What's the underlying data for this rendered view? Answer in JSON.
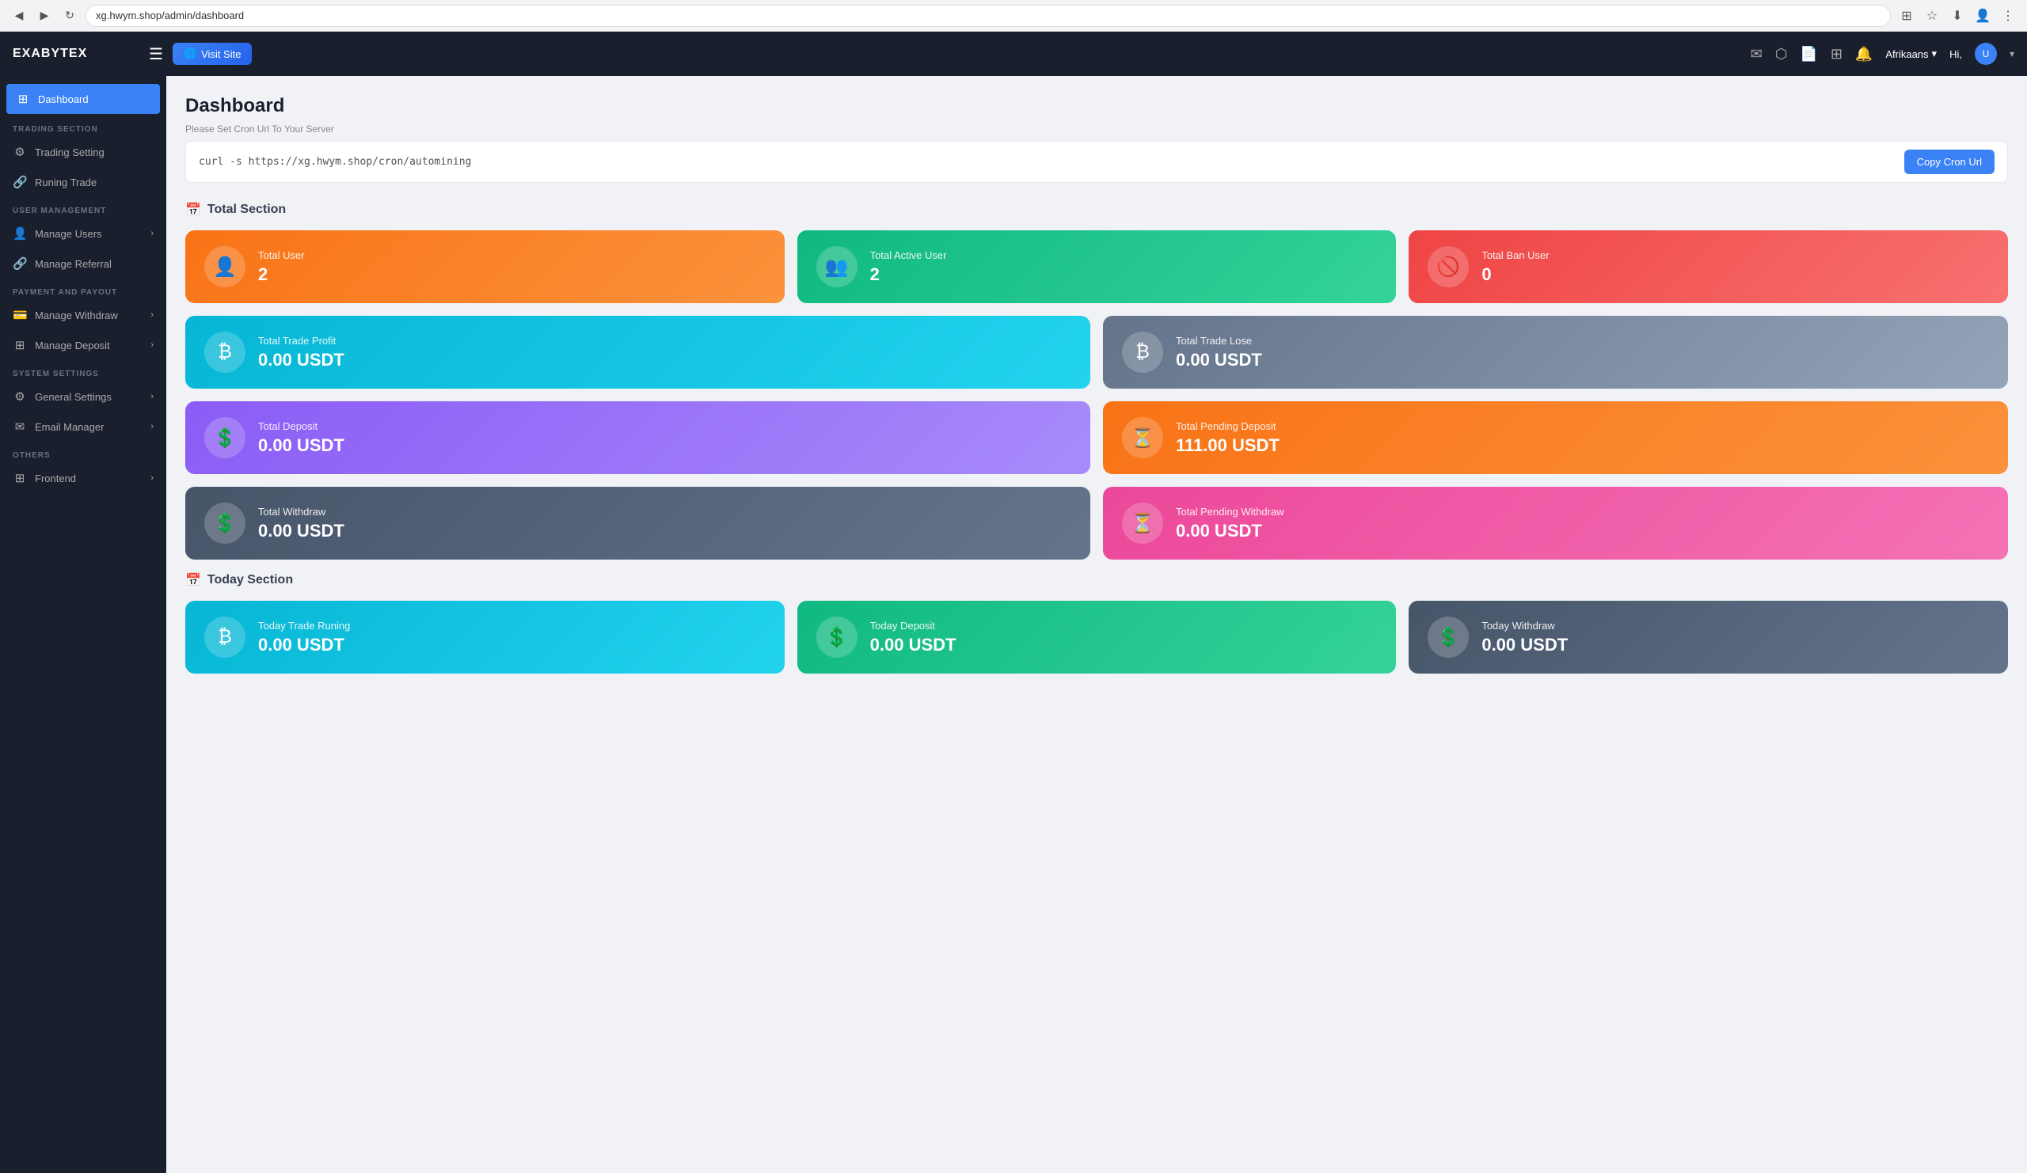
{
  "browser": {
    "url": "xg.hwym.shop/admin/dashboard",
    "back_icon": "◀",
    "forward_icon": "▶",
    "refresh_icon": "↻"
  },
  "header": {
    "brand": "EXABYTEX",
    "hamburger_icon": "☰",
    "visit_site_label": "Visit Site",
    "visit_site_icon": "🌐",
    "language": "Afrikaans",
    "hi_text": "Hi,",
    "icons": {
      "mail": "✉",
      "cube": "⬡",
      "doc": "📄",
      "grid": "⊞",
      "bell": "🔔"
    }
  },
  "sidebar": {
    "active_item": "Dashboard",
    "items": [
      {
        "label": "Dashboard",
        "icon": "⊞",
        "active": true,
        "section": null
      },
      {
        "label": "TRADING SECTION",
        "type": "section"
      },
      {
        "label": "Trading Setting",
        "icon": "⚙",
        "active": false,
        "has_chevron": false
      },
      {
        "label": "Runing Trade",
        "icon": "🔗",
        "active": false,
        "has_chevron": false
      },
      {
        "label": "USER MANAGEMENT",
        "type": "section"
      },
      {
        "label": "Manage Users",
        "icon": "👤",
        "active": false,
        "has_chevron": true
      },
      {
        "label": "Manage Referral",
        "icon": "🔗",
        "active": false,
        "has_chevron": false
      },
      {
        "label": "PAYMENT AND PAYOUT",
        "type": "section"
      },
      {
        "label": "Manage Withdraw",
        "icon": "💳",
        "active": false,
        "has_chevron": true
      },
      {
        "label": "Manage Deposit",
        "icon": "⊞",
        "active": false,
        "has_chevron": true
      },
      {
        "label": "SYSTEM SETTINGS",
        "type": "section"
      },
      {
        "label": "General Settings",
        "icon": "⚙",
        "active": false,
        "has_chevron": true
      },
      {
        "label": "Email Manager",
        "icon": "✉",
        "active": false,
        "has_chevron": true
      },
      {
        "label": "OTHERS",
        "type": "section"
      },
      {
        "label": "Frontend",
        "icon": "⊞",
        "active": false,
        "has_chevron": true
      }
    ]
  },
  "content": {
    "page_title": "Dashboard",
    "cron_hint": "Please Set Cron Url To Your Server",
    "cron_url": "curl -s https://xg.hwym.shop/cron/automining",
    "copy_cron_label": "Copy Cron Url",
    "total_section_title": "Total Section",
    "today_section_title": "Today Section",
    "stats": [
      {
        "label": "Total User",
        "value": "2",
        "card_class": "card-orange",
        "icon": "👤"
      },
      {
        "label": "Total Active User",
        "value": "2",
        "card_class": "card-green",
        "icon": "👥"
      },
      {
        "label": "Total Ban User",
        "value": "0",
        "card_class": "card-red",
        "icon": "🚫"
      },
      {
        "label": "Total Trade Profit",
        "value": "0.00 USDT",
        "card_class": "card-teal",
        "icon": "₿"
      },
      {
        "label": "Total Trade Lose",
        "value": "0.00 USDT",
        "card_class": "card-slate",
        "icon": "₿"
      },
      {
        "label": "Total Deposit",
        "value": "0.00 USDT",
        "card_class": "card-purple",
        "icon": "💲"
      },
      {
        "label": "Total Pending Deposit",
        "value": "111.00 USDT",
        "card_class": "card-orange2",
        "icon": "⏳"
      },
      {
        "label": "Total Withdraw",
        "value": "0.00 USDT",
        "card_class": "card-darkslate",
        "icon": "💲"
      },
      {
        "label": "Total Pending Withdraw",
        "value": "0.00 USDT",
        "card_class": "card-pink",
        "icon": "⏳"
      }
    ],
    "today_stats": [
      {
        "label": "Today Trade Runing",
        "value": "0.00 USDT",
        "card_class": "card-teal",
        "icon": "₿"
      },
      {
        "label": "Today Deposit",
        "value": "0.00 USDT",
        "card_class": "card-green",
        "icon": "💲"
      },
      {
        "label": "Today Withdraw",
        "value": "0.00 USDT",
        "card_class": "card-darkslate",
        "icon": "💲"
      }
    ]
  }
}
